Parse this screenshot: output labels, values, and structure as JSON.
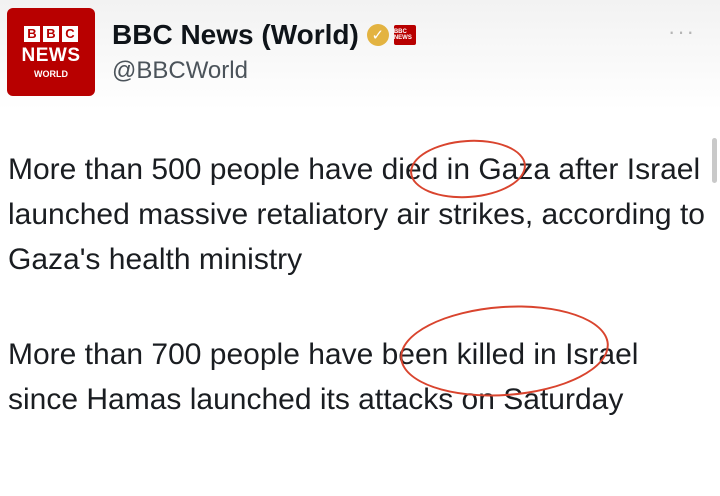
{
  "account": {
    "logo": {
      "top": "BBC",
      "middle": "NEWS",
      "bottom": "WORLD"
    },
    "display_name": "BBC News (World)",
    "handle": "@BBCWorld",
    "verified_icon": "gold-verified-badge-icon",
    "affiliate_badge_text": "BBC NEWS",
    "more_icon": "more-options-icon"
  },
  "tweet": {
    "paragraphs": [
      "More than 500 people have died in Gaza after Israel launched massive retaliatory air strikes, according to Gaza's health ministry",
      "More than 700 people have been killed in Israel since Hamas launched its attacks on Saturday"
    ]
  },
  "annotations": {
    "circle_color": "#d9442e",
    "circled_phrases": [
      "died",
      "been killed"
    ]
  }
}
